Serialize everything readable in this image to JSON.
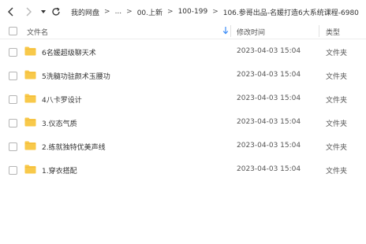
{
  "nav": {
    "back_icon": "chevron-left-icon",
    "forward_icon": "chevron-right-icon",
    "dropdown_icon": "caret-down-icon",
    "refresh_icon": "refresh-icon"
  },
  "breadcrumb": {
    "items": [
      "我的网盘",
      "...",
      "00.上新",
      "100-199",
      "106.参哥出品-名媛打造6大系统课程-6980"
    ],
    "separator": ">"
  },
  "header": {
    "name_label": "文件名",
    "date_label": "修改时间",
    "type_label": "类型",
    "sort_icon": "sort-down-arrow-icon",
    "accent_color": "#3b8cf7"
  },
  "files": [
    {
      "name": "6名媛超级聊天术",
      "modified": "2023-04-03 15:04",
      "type": "文件夹"
    },
    {
      "name": "5洗髓功驻颜术玉腰功",
      "modified": "2023-04-03 15:04",
      "type": "文件夹"
    },
    {
      "name": "4八卡罗设计",
      "modified": "2023-04-03 15:04",
      "type": "文件夹"
    },
    {
      "name": "3.仪态气质",
      "modified": "2023-04-03 15:04",
      "type": "文件夹"
    },
    {
      "name": "2.练就独特优美声线",
      "modified": "2023-04-03 15:04",
      "type": "文件夹"
    },
    {
      "name": "1.穿衣搭配",
      "modified": "2023-04-03 15:04",
      "type": "文件夹"
    }
  ],
  "folder_color": "#f8c94a"
}
